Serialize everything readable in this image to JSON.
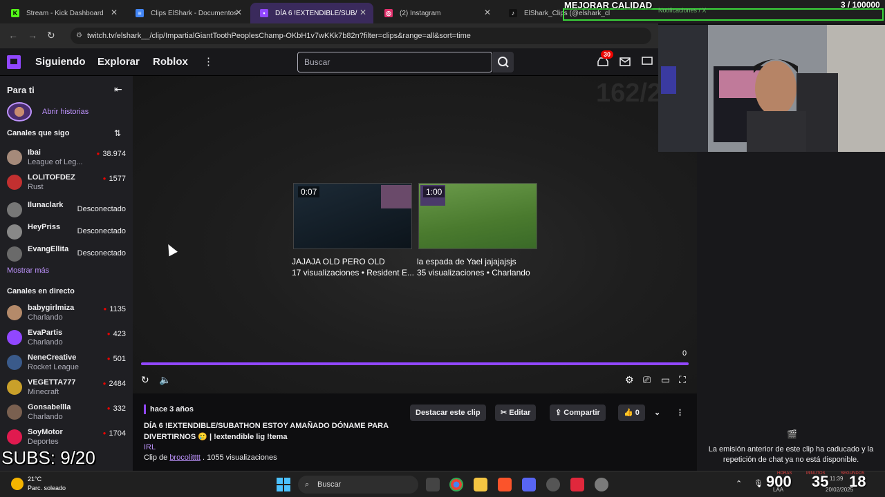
{
  "browser": {
    "tabs": [
      {
        "label": "Stream - Kick Dashboard",
        "icon": "kick-icon",
        "color": "#53fc18"
      },
      {
        "label": "Clips ElShark - Documentos",
        "icon": "docs-icon",
        "color": "#4285f4"
      },
      {
        "label": "DÍA 6 !EXTENDIBLE/SUB/",
        "icon": "twitch-icon",
        "color": "#9147ff"
      },
      {
        "label": "(2) Instagram",
        "icon": "instagram-icon",
        "color": "#e1306c"
      },
      {
        "label": "ElShark_Clips (@elshark_cl",
        "icon": "tiktok-icon",
        "color": "#000000"
      }
    ],
    "url": "twitch.tv/elshark__/clip/ImpartialGiantToothPeoplesChamp-OKbH1v7wKKk7b82n?filter=clips&range=all&sort=time"
  },
  "overlay": {
    "title": "MEJORAR CALIDAD",
    "count": "3  / 100000",
    "ghost_text": "Notificaciones / X",
    "subs": "SUBS: 9/20"
  },
  "topnav": {
    "links": [
      "Siguiendo",
      "Explorar",
      "Roblox"
    ],
    "search_placeholder": "Buscar",
    "notif_count": "30"
  },
  "sidebar": {
    "title": "Para ti",
    "stories": "Abrir historias",
    "followed_title": "Canales que sigo",
    "followed": [
      {
        "name": "Ibai",
        "game": "League of Leg...",
        "viewers": "38.974",
        "color": "#a58a7a"
      },
      {
        "name": "LOLITOFDEZ",
        "game": "Rust",
        "viewers": "1577",
        "color": "#c23030"
      },
      {
        "name": "Iluna­clark",
        "status": "Desconectado",
        "color": "#777"
      },
      {
        "name": "HeyPriss",
        "status": "Desconectado",
        "color": "#888"
      },
      {
        "name": "EvangEllita",
        "status": "Desconectado",
        "color": "#6a6a6a"
      }
    ],
    "show_more": "Mostrar más",
    "live_title": "Canales en directo",
    "live": [
      {
        "name": "babygirlmiza",
        "game": "Charlando",
        "viewers": "1135",
        "color": "#b48a6a"
      },
      {
        "name": "EvaPartis",
        "game": "Charlando",
        "viewers": "423",
        "color": "#9147ff"
      },
      {
        "name": "NeneCreative",
        "game": "Rocket League",
        "viewers": "501",
        "color": "#3a5a8a"
      },
      {
        "name": "VEGETTA777",
        "game": "Minecraft",
        "viewers": "2484",
        "color": "#c9a02a"
      },
      {
        "name": "Gonsabellla",
        "game": "Charlando",
        "viewers": "332",
        "color": "#7a6050"
      },
      {
        "name": "SoyMotor",
        "game": "Deportes",
        "viewers": "1704",
        "color": "#e01a4f"
      }
    ]
  },
  "player": {
    "ghost_text": "162/2",
    "recommended": [
      {
        "duration": "0:07",
        "title": "JAJAJA OLD PERO OLD",
        "meta": "17 visualizaciones • Resident E..."
      },
      {
        "duration": "1:00",
        "title": "la espada de Yael jajajajsjs",
        "meta": "35 visualizaciones • Charlando"
      }
    ],
    "progress": 1.0,
    "progress_label": "0"
  },
  "clip": {
    "age": "hace 3 años",
    "title": "DÍA 6 !EXTENDIBLE/SUBATHON ESTOY AMAÑADO DÓNAME PARA DIVERTIRNOS 🥲 | !extendible lig !tema",
    "category": "IRL",
    "clip_by_prefix": "Clip de",
    "author": "brocolitttt",
    "views": " . 1055 visualizaciones",
    "actions": {
      "highlight": "Destacar este clip",
      "edit": "Editar",
      "share": "Compartir",
      "likes": "0"
    }
  },
  "chat": {
    "message": "La emisión anterior de este clip ha caducado y la repetición de chat ya no está disponible."
  },
  "taskbar": {
    "temp": "21°C",
    "weather": "Parc. soleado",
    "search": "Buscar",
    "timer": [
      "900",
      "35",
      "18"
    ],
    "timer_labels": [
      "HORAS",
      "MINUTOS",
      "SEGUNDOS"
    ],
    "lang": "LAA",
    "time": "11:39",
    "date": "20/02/2025"
  }
}
